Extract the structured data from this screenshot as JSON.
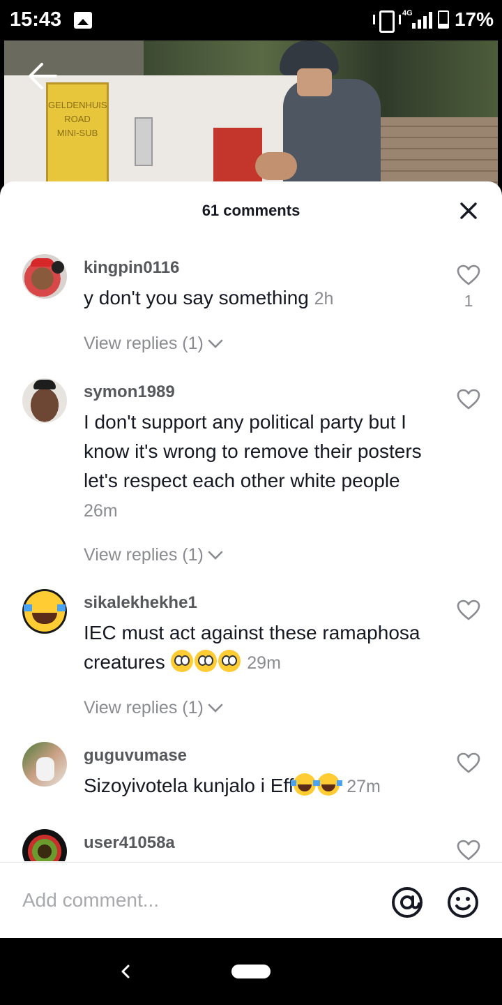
{
  "status_bar": {
    "time": "15:43",
    "network": "4G",
    "battery": "17%"
  },
  "sheet": {
    "title": "61 comments"
  },
  "comments": [
    {
      "username": "kingpin0116",
      "text": "y don't you say something",
      "time": "2h",
      "likes": "1",
      "replies": "View replies (1)"
    },
    {
      "username": "symon1989",
      "text": "I don't support any political party but I know it's wrong to remove their posters let's respect each other white people",
      "time": "26m",
      "likes": "",
      "replies": "View replies (1)"
    },
    {
      "username": "sikalekhekhe1",
      "text": "IEC must act against these ramaphosa creatures",
      "emoji": "flushed-face x3",
      "time": "29m",
      "likes": "",
      "replies": "View replies (1)"
    },
    {
      "username": "guguvumase",
      "text": "Sizoyivotela kunjalo i Eff",
      "emoji": "tears-of-joy x2",
      "time": "27m",
      "likes": "",
      "replies": ""
    },
    {
      "username": "user41058a",
      "text": "",
      "time": "",
      "likes": "",
      "replies": ""
    }
  ],
  "input": {
    "placeholder": "Add comment..."
  },
  "video_sign_text": [
    "GELDENHUIS",
    "ROAD",
    "MINI-SUB"
  ],
  "icons": [
    "back-arrow-icon",
    "close-icon",
    "heart-icon",
    "chevron-down-icon",
    "at-icon",
    "emoji-icon"
  ]
}
